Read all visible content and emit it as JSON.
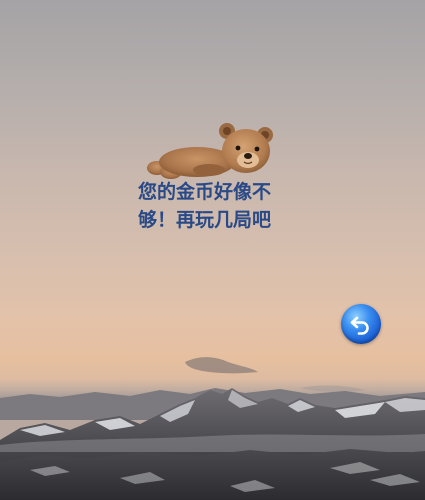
{
  "message": {
    "text": "您的金币好像不够！再玩几局吧"
  },
  "icons": {
    "teddy": "teddy-bear-lying-icon",
    "back": "undo-arrow-icon"
  },
  "colors": {
    "message_text": "#2a4a87",
    "back_button": "#2a7de8"
  }
}
